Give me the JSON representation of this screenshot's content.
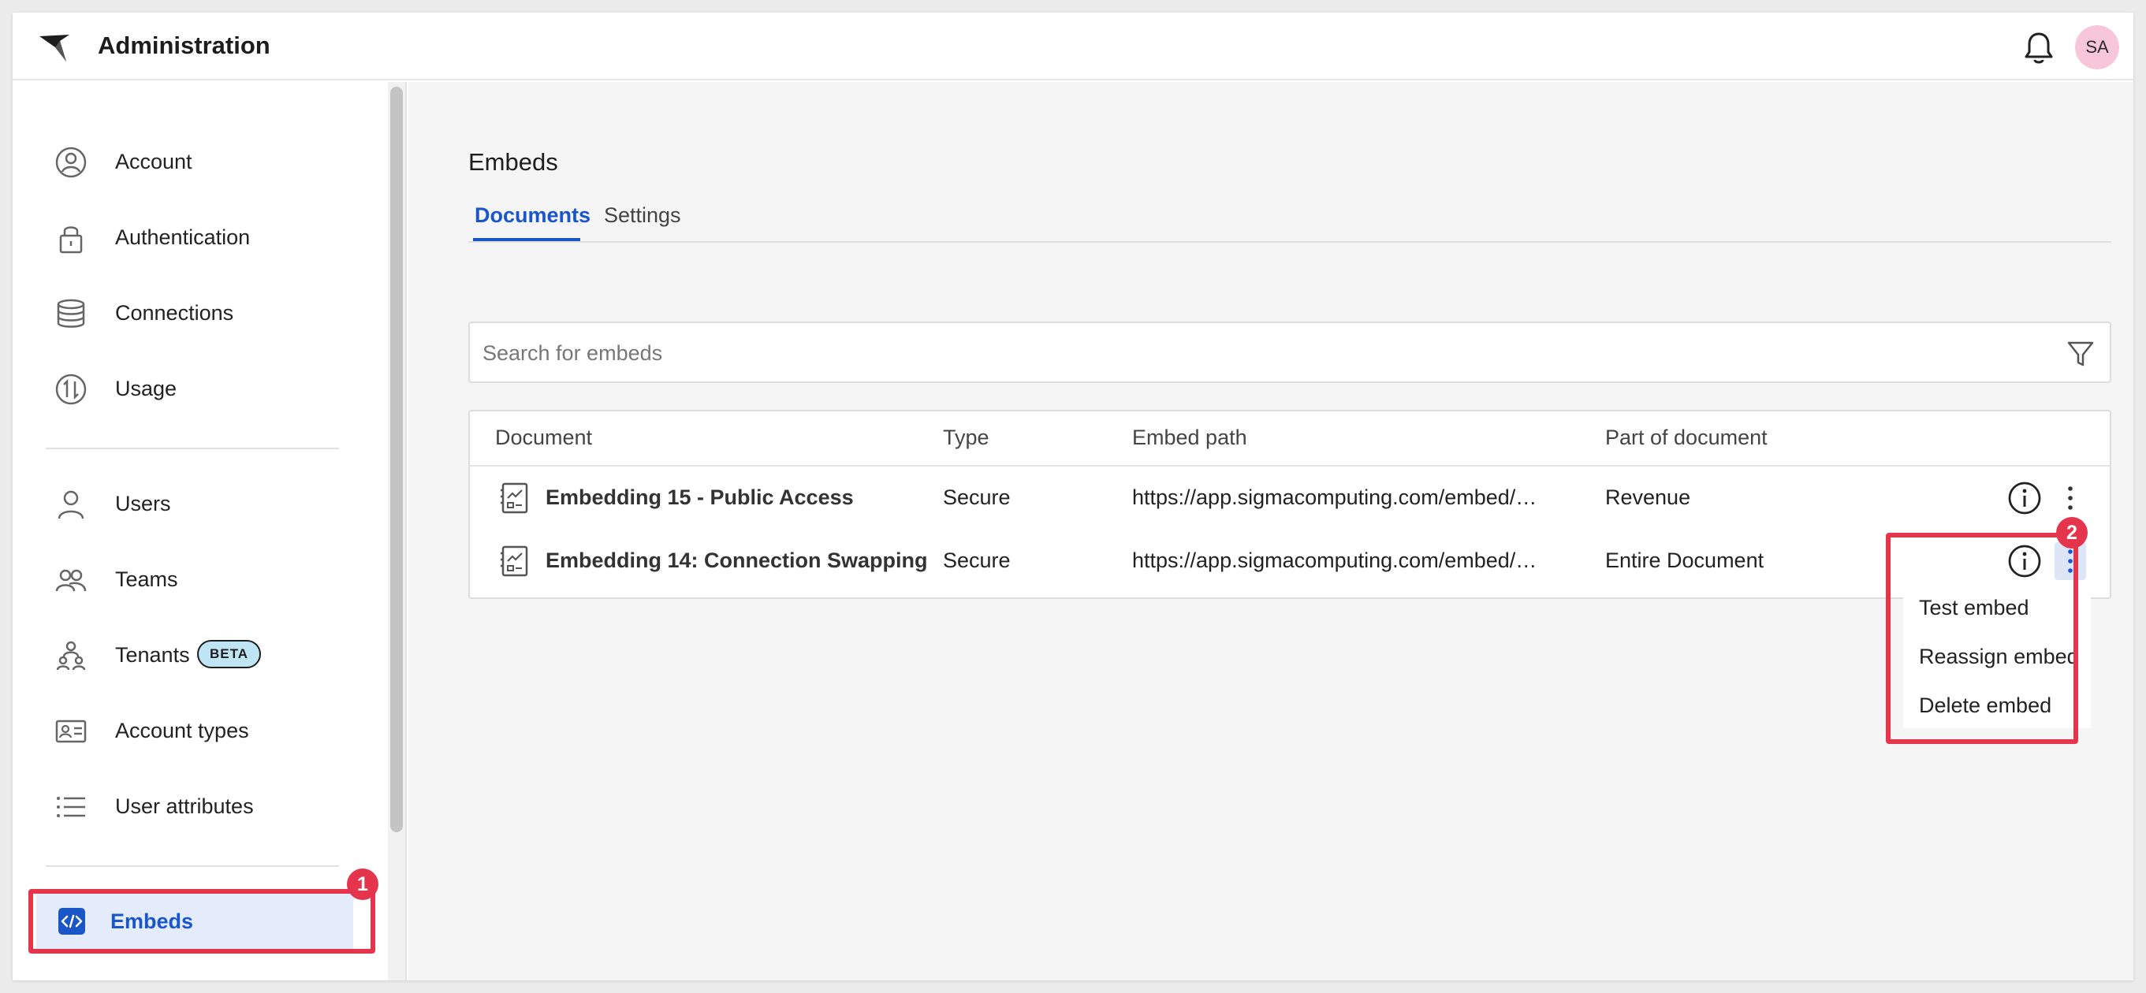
{
  "header": {
    "title": "Administration",
    "notifications_icon": "bell-icon",
    "avatar_initials": "SA",
    "avatar_color": "#f7c6d9"
  },
  "sidebar": {
    "items": [
      {
        "label": "Account",
        "icon": "user-circle-icon"
      },
      {
        "label": "Authentication",
        "icon": "lock-icon"
      },
      {
        "label": "Connections",
        "icon": "database-icon"
      },
      {
        "label": "Usage",
        "icon": "usage-icon"
      },
      {
        "label": "Users",
        "icon": "user-icon"
      },
      {
        "label": "Teams",
        "icon": "team-icon"
      },
      {
        "label": "Tenants",
        "icon": "tenants-icon",
        "badge": "BETA"
      },
      {
        "label": "Account types",
        "icon": "id-card-icon"
      },
      {
        "label": "User attributes",
        "icon": "list-icon"
      },
      {
        "label": "Embeds",
        "icon": "code-icon",
        "active": true
      }
    ],
    "highlight_badge": "1"
  },
  "main": {
    "section_title": "Embeds",
    "tabs": [
      {
        "label": "Documents",
        "active": true
      },
      {
        "label": "Settings",
        "active": false
      }
    ],
    "search": {
      "placeholder": "Search for embeds",
      "value": ""
    },
    "table": {
      "columns": [
        "Document",
        "Type",
        "Embed path",
        "Part of document"
      ],
      "rows": [
        {
          "document": "Embedding 15 - Public Access",
          "type": "Secure",
          "embed_path": "https://app.sigmacomputing.com/embed/…",
          "part": "Revenue"
        },
        {
          "document": "Embedding 14: Connection Swapping",
          "type": "Secure",
          "embed_path": "https://app.sigmacomputing.com/embed/…",
          "part": "Entire Document"
        }
      ]
    },
    "row_menu": {
      "items": [
        "Test embed",
        "Reassign embed",
        "Delete embed"
      ],
      "highlight_badge": "2"
    }
  },
  "colors": {
    "accent": "#1a56c8",
    "highlight": "#e5354d",
    "active_bg": "#e4ebfb",
    "beta_bg": "#bfe5f5"
  }
}
